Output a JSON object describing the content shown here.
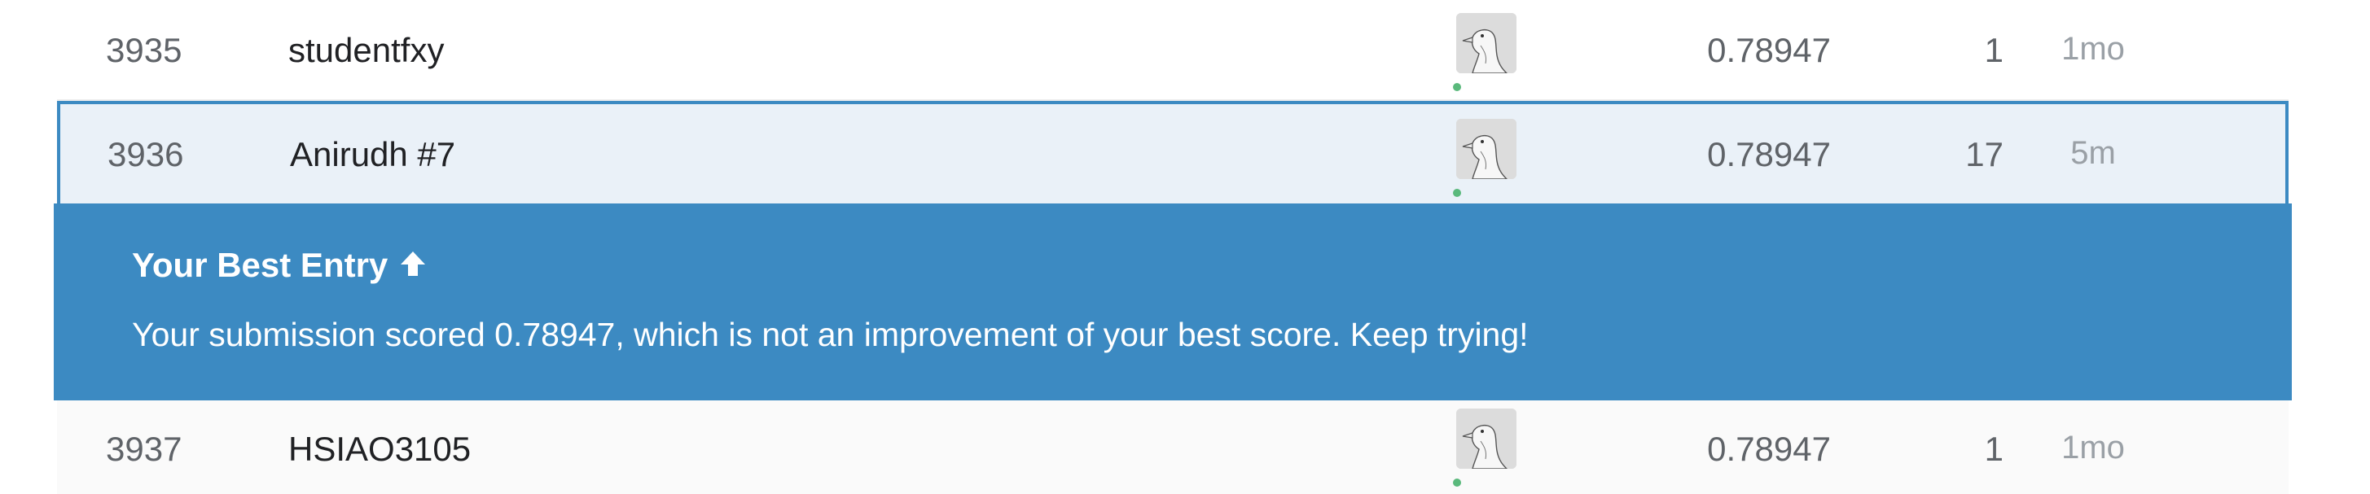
{
  "leaderboard": {
    "rows": [
      {
        "rank": "3935",
        "team": "studentfxy",
        "score": "0.78947",
        "entries": "1",
        "last": "1mo",
        "avatar_icon": "goose-avatar-icon",
        "online": true
      },
      {
        "rank": "3936",
        "team": "Anirudh #7",
        "score": "0.78947",
        "entries": "17",
        "last": "5m",
        "avatar_icon": "goose-avatar-icon",
        "online": true,
        "highlighted": true
      },
      {
        "rank": "3937",
        "team": "HSIAO3105",
        "score": "0.78947",
        "entries": "1",
        "last": "1mo",
        "avatar_icon": "goose-avatar-icon",
        "online": true
      }
    ]
  },
  "banner": {
    "title": "Your Best Entry",
    "title_icon": "arrow-up-icon",
    "message": "Your submission scored 0.78947, which is not an improvement of your best score. Keep trying!"
  },
  "colors": {
    "accent": "#3c8ac2",
    "highlight_row": "#eaf1f8",
    "online_dot": "#5ab97c"
  }
}
